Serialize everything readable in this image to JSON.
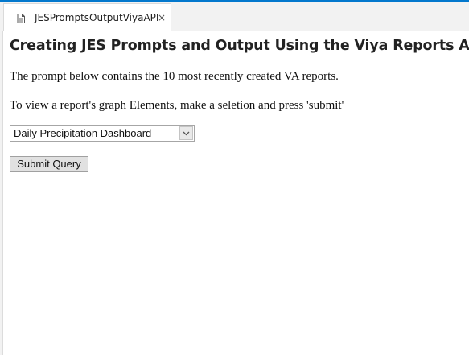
{
  "tab": {
    "label": "JESPromptsOutputViyaAPI",
    "close_glyph": "×",
    "icon": "document-icon"
  },
  "page": {
    "title": "Creating JES Prompts and Output Using the Viya Reports API",
    "paragraph_1": "The prompt below contains the 10 most recently created VA reports.",
    "paragraph_2": "To view a report's graph Elements, make a seletion and press 'submit'"
  },
  "form": {
    "report_select_value": "Daily Precipitation Dashboard",
    "submit_label": "Submit Query"
  },
  "colors": {
    "accent": "#0378cd",
    "tab_bar": "#f2f2f2"
  }
}
